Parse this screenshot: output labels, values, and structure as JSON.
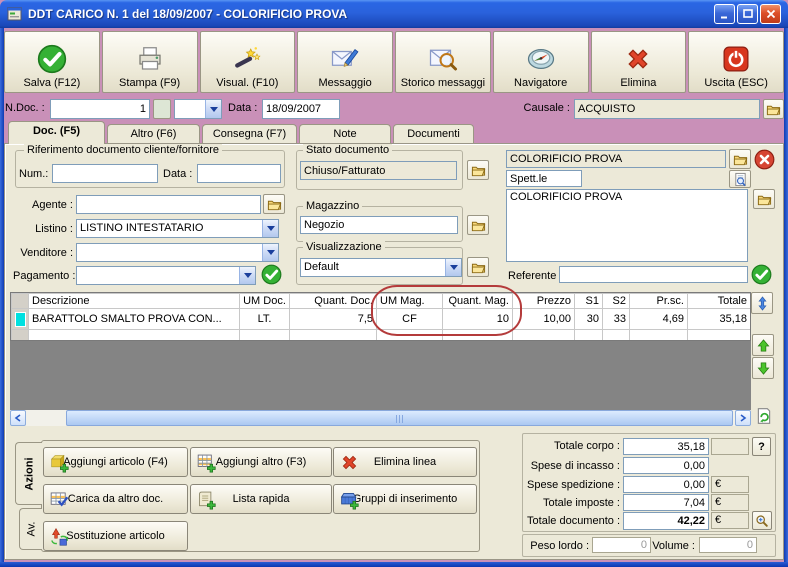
{
  "window": {
    "title": "DDT CARICO N. 1  del 18/09/2007 - COLORIFICIO PROVA"
  },
  "toolbar": {
    "buttons": [
      {
        "label": "Salva (F12)",
        "icon": "save-check-icon"
      },
      {
        "label": "Stampa (F9)",
        "icon": "printer-icon"
      },
      {
        "label": "Visual. (F10)",
        "icon": "magic-wand-icon"
      },
      {
        "label": "Messaggio",
        "icon": "message-icon"
      },
      {
        "label": "Storico messaggi",
        "icon": "message-history-icon"
      },
      {
        "label": "Navigatore",
        "icon": "compass-icon"
      },
      {
        "label": "Elimina",
        "icon": "delete-x-icon"
      },
      {
        "label": "Uscita (ESC)",
        "icon": "power-icon"
      }
    ]
  },
  "doc_header": {
    "ndoc_label": "N.Doc. :",
    "ndoc_value": "1",
    "combo_value": "",
    "data_label": "Data :",
    "data_value": "18/09/2007",
    "causale_label": "Causale :",
    "causale_value": "ACQUISTO"
  },
  "tabs": [
    {
      "label": "Doc. (F5)",
      "active": true
    },
    {
      "label": "Altro (F6)",
      "active": false
    },
    {
      "label": "Consegna (F7)",
      "active": false
    },
    {
      "label": "Note",
      "active": false
    },
    {
      "label": "Documenti",
      "active": false
    }
  ],
  "riferimento": {
    "group_title": "Riferimento documento cliente/fornitore",
    "num_label": "Num.:",
    "num_value": "",
    "data_label": "Data :",
    "data_value": ""
  },
  "form_left": {
    "agente_label": "Agente :",
    "agente_value": "",
    "listino_label": "Listino :",
    "listino_value": "LISTINO INTESTATARIO",
    "venditore_label": "Venditore :",
    "venditore_value": "",
    "pagamento_label": "Pagamento :",
    "pagamento_value": ""
  },
  "stato": {
    "group_title": "Stato documento",
    "value": "Chiuso/Fatturato"
  },
  "magazzino": {
    "group_title": "Magazzino",
    "value": "Negozio"
  },
  "visualizzazione": {
    "group_title": "Visualizzazione",
    "value": "Default"
  },
  "intestatario": {
    "cliente_value": "COLORIFICIO PROVA",
    "spettle_value": "Spett.le",
    "indirizzo_value": "COLORIFICIO PROVA",
    "referente_label": "Referente",
    "referente_value": ""
  },
  "table": {
    "columns": [
      "",
      "Descrizione",
      "UM Doc.",
      "Quant. Doc.",
      "UM Mag.",
      "Quant. Mag.",
      "Prezzo",
      "S1",
      "S2",
      "Pr.sc.",
      "Totale"
    ],
    "rows": [
      [
        "BARATTOLO SMALTO PROVA  CON...",
        "LT.",
        "7,5",
        "CF",
        "10",
        "10,00",
        "30",
        "33",
        "4,69",
        "35,18"
      ]
    ],
    "annotation": "red ellipse around UM Mag. / Quant. Mag. columns"
  },
  "actions": {
    "tab_azioni": "Azioni",
    "tab_avanti": "Av.",
    "buttons": [
      {
        "label": "Aggiungi articolo (F4)",
        "icon": "cube-plus-icon"
      },
      {
        "label": "Aggiungi altro (F3)",
        "icon": "grid-plus-icon"
      },
      {
        "label": "Elimina linea",
        "icon": "delete-x-icon"
      },
      {
        "label": "Carica da altro doc.",
        "icon": "grid-check-icon"
      },
      {
        "label": "Lista rapida",
        "icon": "list-plus-icon"
      },
      {
        "label": "Gruppi di inserimento",
        "icon": "box-plus-icon"
      },
      {
        "label": "Sostituzione articolo",
        "icon": "swap-icon"
      }
    ]
  },
  "totals": {
    "corpo_label": "Totale corpo :",
    "corpo_value": "35,18",
    "incasso_label": "Spese di incasso :",
    "incasso_value": "0,00",
    "spedizione_label": "Spese spedizione :",
    "spedizione_value": "0,00",
    "spedizione_unit": "€",
    "imposte_label": "Totale imposte :",
    "imposte_value": "7,04",
    "imposte_unit": "€",
    "documento_label": "Totale documento :",
    "documento_value": "42,22",
    "documento_unit": "€",
    "help_button": "?"
  },
  "footer": {
    "peso_label": "Peso lordo :",
    "peso_value": "0",
    "volume_label": "Volume :",
    "volume_value": "0"
  }
}
